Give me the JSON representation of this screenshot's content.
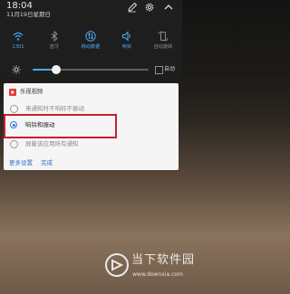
{
  "status_bar": {
    "time": "18:04",
    "date": "11月19日星期日"
  },
  "header_icons": [
    "edit-icon",
    "settings-icon",
    "collapse-chevron-icon"
  ],
  "quick_toggles": [
    {
      "label": "1301",
      "icon": "wifi-icon",
      "state": "on"
    },
    {
      "label": "蓝牙",
      "icon": "bluetooth-icon",
      "state": "off"
    },
    {
      "label": "移动数据",
      "icon": "mobile-data-icon",
      "state": "on"
    },
    {
      "label": "响铃",
      "icon": "ring-icon",
      "state": "on"
    },
    {
      "label": "自动旋转",
      "icon": "auto-rotate-icon",
      "state": "off"
    }
  ],
  "brightness": {
    "level_fraction": 0.2,
    "auto_label": "自动",
    "auto_checked": false
  },
  "notification": {
    "app_name": "乐视视频",
    "options": [
      {
        "label": "来通知时不响铃不振动",
        "selected": false
      },
      {
        "label": "响铃和振动",
        "selected": true
      },
      {
        "label": "屏蔽该应用所有通知",
        "selected": false
      }
    ],
    "more_settings": "更多设置",
    "done": "完成"
  },
  "watermark": {
    "text": "当下软件园",
    "url": "www.downxia.com"
  },
  "colors": {
    "accent": "#4ea8f2",
    "highlight_box": "#c8202a",
    "card_bg": "#f5f5f5"
  }
}
